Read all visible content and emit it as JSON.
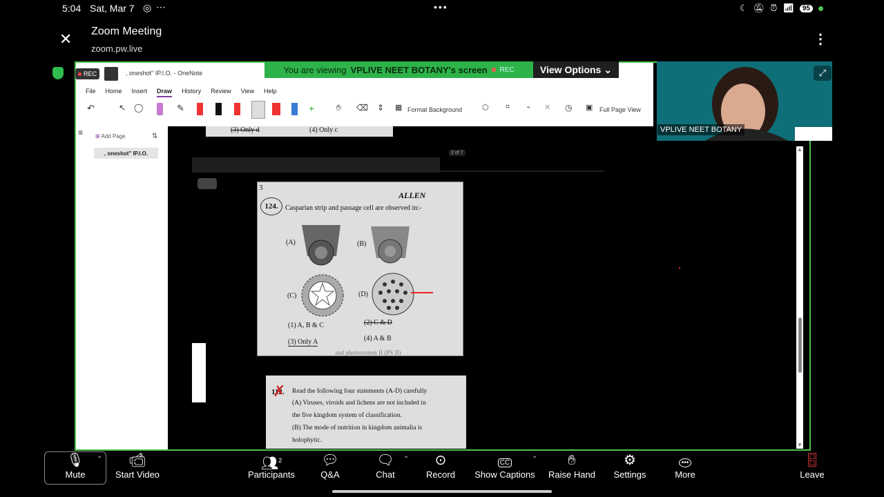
{
  "status_bar": {
    "time": "5:04",
    "date": "Sat, Mar 7",
    "center_dots": "•••",
    "battery": "95",
    "extra_icon": "⋯"
  },
  "header": {
    "title": "Zoom Meeting",
    "subtitle": "zoom.pw.live",
    "close_icon": "close-icon",
    "more_icon": "vertical-dots-icon"
  },
  "share_banner": {
    "viewing_text": "You are viewing",
    "presenter": "VPLIVE NEET BOTANY's screen",
    "rec": "REC",
    "view_options": "View Options"
  },
  "rec_badge": "REC",
  "onenote": {
    "title": ", oneshot\" IP.I.O.  -  OneNote",
    "menu": [
      "File",
      "Home",
      "Insert",
      "Draw",
      "History",
      "Review",
      "View",
      "Help"
    ],
    "active_menu": "Draw",
    "toolbar": {
      "format_background": "Format Background",
      "full_page_view": "Full Page View"
    },
    "sidebar": {
      "add_page": "Add Page",
      "page_item": ", oneshot\" IP.I.O."
    }
  },
  "document": {
    "top_snippet": {
      "opt3": "(3) Only d",
      "opt4": "(4) Only c"
    },
    "page_indicator": "2 of 7",
    "question": {
      "corner_mark": "3",
      "number": "124.",
      "brand": "ALLEN",
      "text": "Casparian strip and passage cell are observed in:-",
      "labels": [
        "(A)",
        "(B)",
        "(C)",
        "(D)"
      ],
      "options": [
        "(1) A, B & C",
        "(2) C & D",
        "(3) Only A",
        "(4) A & B"
      ],
      "bottom_cut": "and photosystem II (PS II)"
    },
    "question2": {
      "number": "112.",
      "line1": "Read the following four statements (A-D) carefully",
      "line2": "(A) Viruses, viroids and lichens are not included in",
      "line3": "the five kingdom system of classification.",
      "line4": "(B) The mode of nutrition in kingdom animalia is",
      "line5": "holophytic."
    }
  },
  "participant_video": {
    "name": "VPLIVE NEET BOTANY"
  },
  "bottom_bar": [
    {
      "label": "Mute",
      "icon": "microphone-icon"
    },
    {
      "label": "Start Video",
      "icon": "video-off-icon"
    },
    {
      "label": "Participants",
      "icon": "participants-icon",
      "count": "2"
    },
    {
      "label": "Q&A",
      "icon": "qa-icon"
    },
    {
      "label": "Chat",
      "icon": "chat-icon"
    },
    {
      "label": "Record",
      "icon": "record-icon"
    },
    {
      "label": "Show Captions",
      "icon": "cc-icon"
    },
    {
      "label": "Raise Hand",
      "icon": "hand-icon"
    },
    {
      "label": "Settings",
      "icon": "gear-icon"
    },
    {
      "label": "More",
      "icon": "more-icon"
    },
    {
      "label": "Leave",
      "icon": "leave-icon"
    }
  ],
  "colors": {
    "share_border": "#4ec44e",
    "banner_bg": "#2db34a",
    "video_bg": "#0e6f78",
    "rec_red": "#ff4444"
  }
}
